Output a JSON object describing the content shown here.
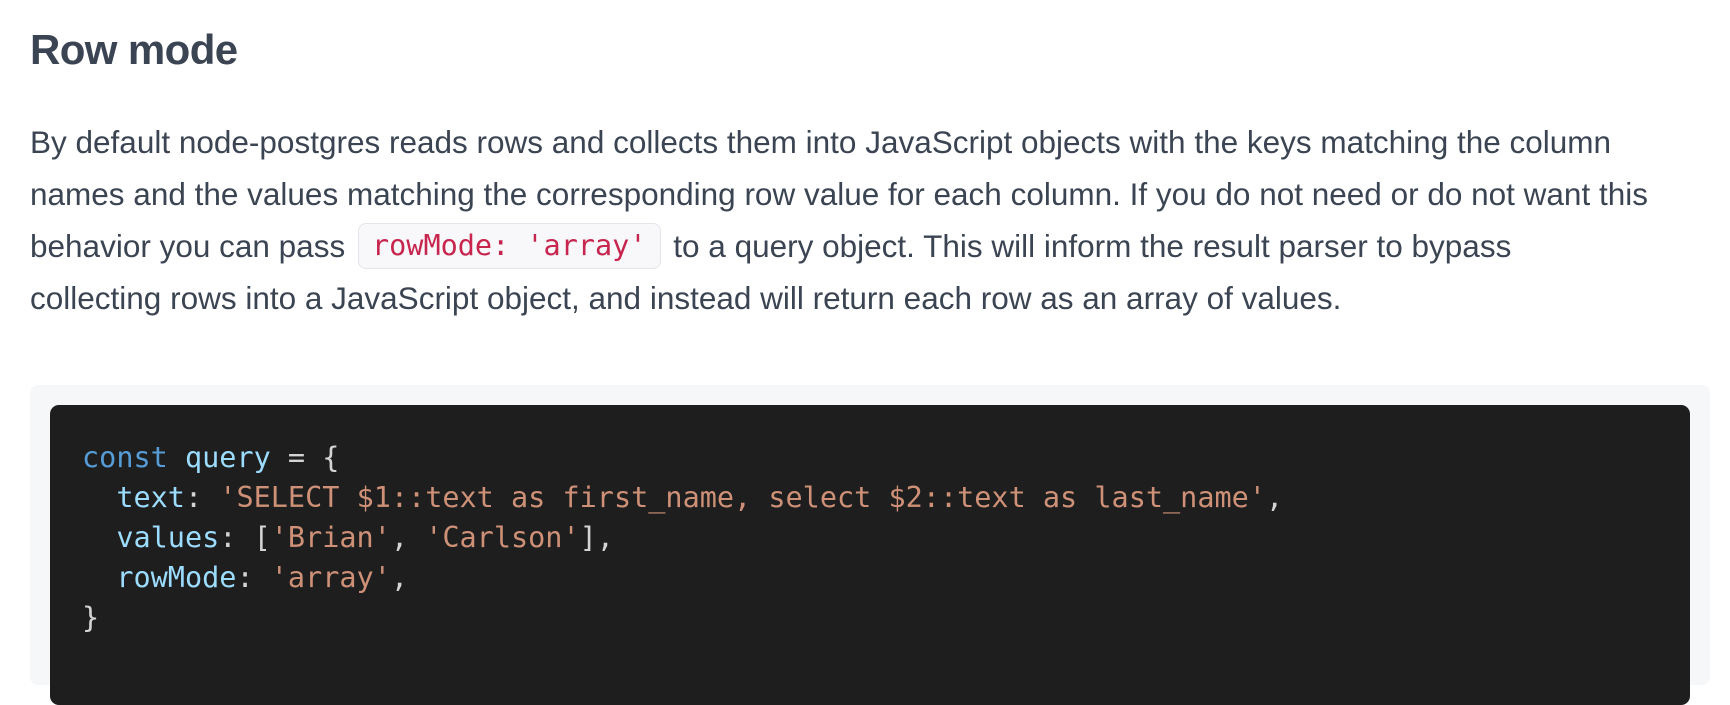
{
  "heading": "Row mode",
  "paragraph": {
    "line1": "By default node-postgres reads rows and collects them into JavaScript objects with the keys matching the column",
    "line2": "names and the values matching the corresponding row value for each column. If you do not need or do not want this",
    "line3_before": "behavior you can pass",
    "inline_code": "rowMode: 'array'",
    "line3_after": "to a query object. This will inform the result parser to bypass",
    "line4": "collecting rows into a JavaScript object, and instead will return each row as an array of values."
  },
  "code": {
    "language": "javascript",
    "line1": {
      "keyword": "const",
      "name": "query",
      "rest": " = {"
    },
    "line2": {
      "indent": "  ",
      "key": "text",
      "sep": ": ",
      "value": "'SELECT $1::text as first_name, select $2::text as last_name'",
      "end": ","
    },
    "line3": {
      "indent": "  ",
      "key": "values",
      "sep": ": [",
      "value1": "'Brian'",
      "comma": ", ",
      "value2": "'Carlson'",
      "end": "],"
    },
    "line4": {
      "indent": "  ",
      "key": "rowMode",
      "sep": ": ",
      "value": "'array'",
      "end": ","
    },
    "line5": "}"
  },
  "colors": {
    "text": "#3b4452",
    "inline_code_text": "#c7254e",
    "code_background": "#1e1e1e",
    "keyword": "#569cd6",
    "identifier": "#9cdcfe",
    "string": "#ce9178"
  }
}
